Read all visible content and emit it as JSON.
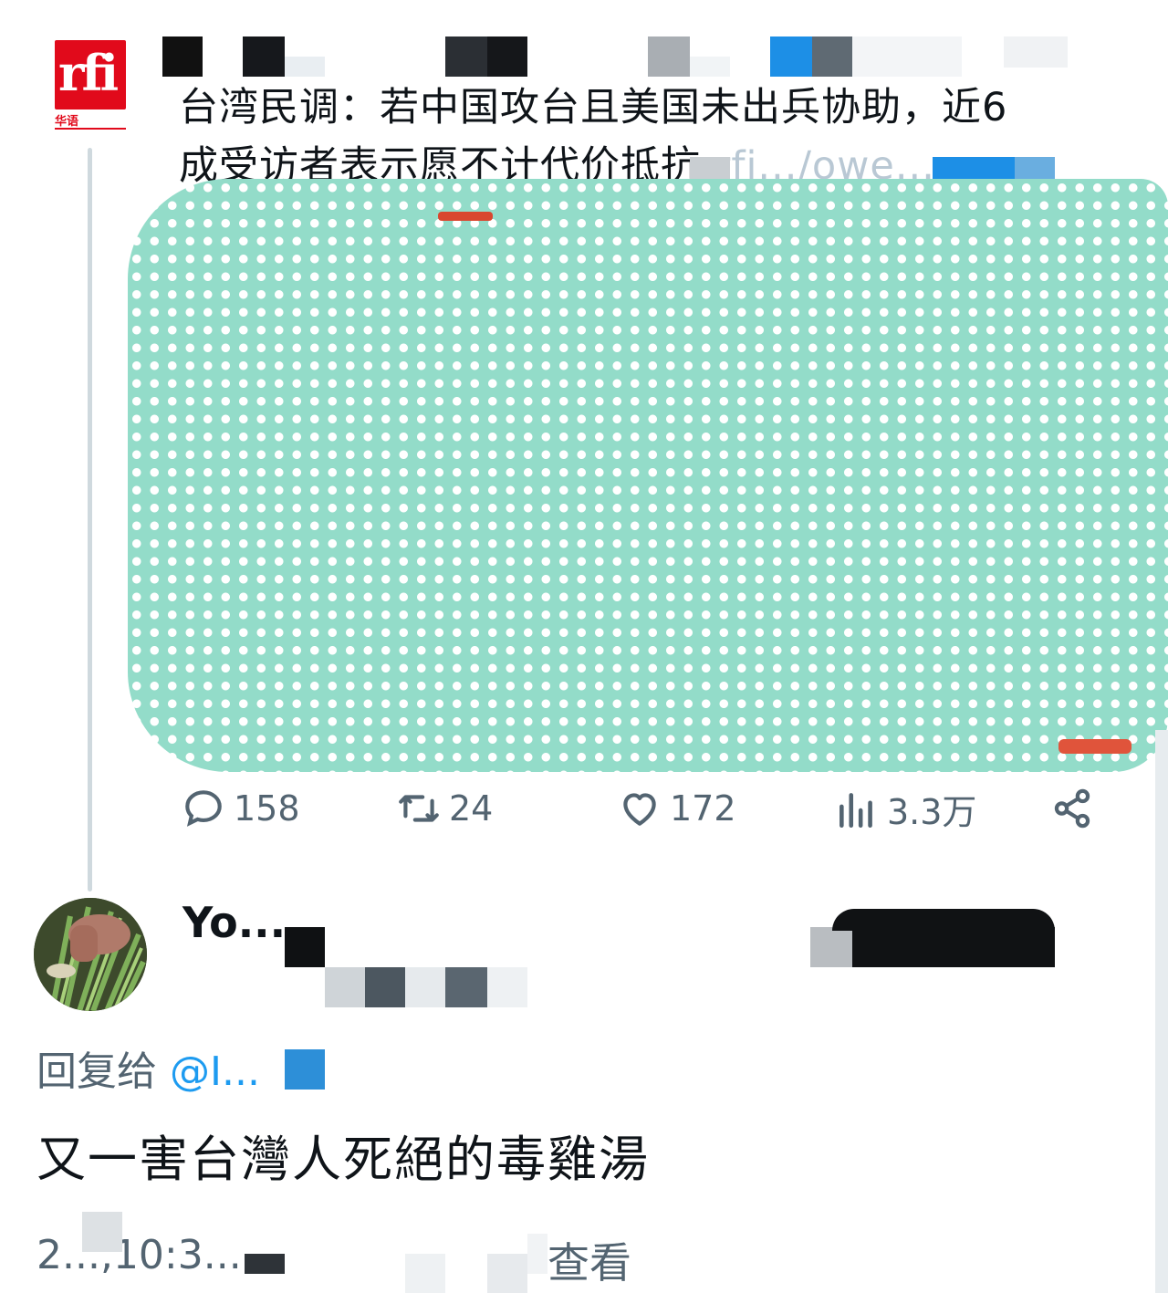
{
  "source": {
    "logo_letters": "rfi",
    "logo_sub": "华语",
    "brand_color": "#e10a1b"
  },
  "tweet": {
    "text_line1": "台湾民调：若中国攻台且美国未出兵协助，近6",
    "text_line2": "成受访者表示愿不计代价抵抗",
    "link_fragment": " rfi.../owe... ",
    "stats": {
      "replies": "158",
      "retweets": "24",
      "likes": "172",
      "views": "3.3万"
    },
    "icons": {
      "reply": "reply-icon",
      "retweet": "retweet-icon",
      "like": "heart-icon",
      "views": "views-icon",
      "share": "share-icon"
    }
  },
  "reply": {
    "name": "Yo...",
    "reply_to_label": "回复给",
    "reply_to_handle": "@I...",
    "text": "又一害台灣人死絕的毒雞湯",
    "time_fragment": "2...,10:3...",
    "view_label": "查看"
  },
  "colors": {
    "accent": "#1d9bf0",
    "muted": "#536471",
    "media_bg": "#93dcc9"
  }
}
